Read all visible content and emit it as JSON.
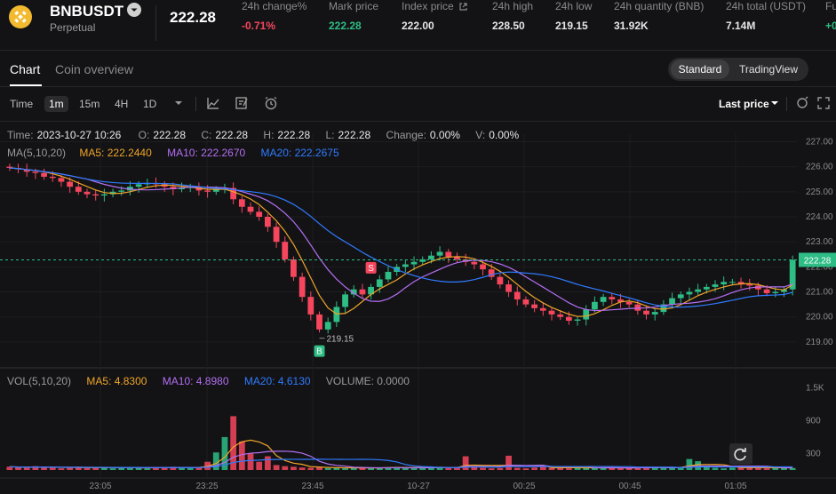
{
  "header": {
    "symbol": "BNBUSDT",
    "subtitle": "Perpetual",
    "last_price": "222.28",
    "stats": [
      {
        "label": "24h change%",
        "value": "-0.71%",
        "color": "#f6465d"
      },
      {
        "label": "Mark price",
        "value": "222.28",
        "color": "#2ebd85"
      },
      {
        "label": "Index price",
        "value": "222.00",
        "color": "#e6e6e6"
      },
      {
        "label": "24h high",
        "value": "228.50",
        "color": "#e6e6e6"
      },
      {
        "label": "24h low",
        "value": "219.15",
        "color": "#e6e6e6"
      },
      {
        "label": "24h quantity (BNB)",
        "value": "31.92K",
        "color": "#e6e6e6"
      },
      {
        "label": "24h total (USDT)",
        "value": "7.14M",
        "color": "#e6e6e6"
      },
      {
        "label": "Fu",
        "value": "+0",
        "color": "#2ebd85"
      }
    ]
  },
  "tabs": {
    "chart": "Chart",
    "coin_overview": "Coin overview"
  },
  "view_switch": {
    "standard": "Standard",
    "tradingview": "TradingView"
  },
  "toolbar": {
    "time_label": "Time",
    "intervals": [
      "1m",
      "15m",
      "4H",
      "1D"
    ],
    "active_interval": "1m",
    "last_price_label": "Last price"
  },
  "ohlc": {
    "time_label": "Time:",
    "time": "2023-10-27 10:26",
    "open_label": "O:",
    "open": "222.28",
    "close_label": "C:",
    "close": "222.28",
    "high_label": "H:",
    "high": "222.28",
    "low_label": "L:",
    "low": "222.28",
    "change_label": "Change:",
    "change": "0.00%",
    "vol_label": "V:",
    "vol": "0.00%"
  },
  "ma_legend": {
    "ma_title": "MA(5,10,20)",
    "ma5": "MA5: 222.2440",
    "ma10": "MA10: 222.2670",
    "ma20": "MA20: 222.2675"
  },
  "vol_legend": {
    "vol_title": "VOL(5,10,20)",
    "ma5": "MA5: 4.8300",
    "ma10": "MA10: 4.8980",
    "ma20": "MA20: 4.6130",
    "volume": "VOLUME: 0.0000"
  },
  "chart_data": {
    "type": "candlestick",
    "price_axis": [
      "227.00",
      "226.00",
      "225.00",
      "224.00",
      "223.00",
      "222.00",
      "221.00",
      "220.00",
      "219.00"
    ],
    "volume_axis": [
      "1.5K",
      "900",
      "300"
    ],
    "time_axis": [
      "23:05",
      "23:25",
      "23:45",
      "10-27",
      "00:25",
      "00:45",
      "01:05"
    ],
    "current_price_tag": "222.28",
    "low_annotation": "219.15",
    "markers": {
      "sell": "S",
      "buy": "B"
    },
    "colors": {
      "up": "#2ebd85",
      "down": "#f6465d",
      "ma5": "#f0a429",
      "ma10": "#b36ff2",
      "ma20": "#2f7bff"
    },
    "ylim": [
      218.5,
      227.3
    ],
    "close_path": [
      225.95,
      225.9,
      225.8,
      225.75,
      225.6,
      225.55,
      225.4,
      225.2,
      225.0,
      224.9,
      224.85,
      224.9,
      225.0,
      225.05,
      225.2,
      225.3,
      225.35,
      225.3,
      225.2,
      225.1,
      225.15,
      225.2,
      225.05,
      225.0,
      225.1,
      225.15,
      224.7,
      224.4,
      224.2,
      224.0,
      223.6,
      223.0,
      222.3,
      221.6,
      220.8,
      220.1,
      219.5,
      219.8,
      220.4,
      220.9,
      221.1,
      220.9,
      221.2,
      221.5,
      221.8,
      222.0,
      222.1,
      222.2,
      222.3,
      222.45,
      222.6,
      222.4,
      222.3,
      222.2,
      222.1,
      221.9,
      221.6,
      221.3,
      221.0,
      220.7,
      220.5,
      220.35,
      220.25,
      220.1,
      220.0,
      219.85,
      219.9,
      220.3,
      220.6,
      220.8,
      220.7,
      220.6,
      220.5,
      220.25,
      220.1,
      220.2,
      220.5,
      220.75,
      220.9,
      221.0,
      221.1,
      221.2,
      221.3,
      221.4,
      221.4,
      221.3,
      221.25,
      221.1,
      220.95,
      221.0,
      221.1,
      222.28
    ],
    "volume_path": [
      60,
      50,
      40,
      70,
      45,
      55,
      30,
      40,
      60,
      35,
      50,
      45,
      30,
      40,
      55,
      35,
      30,
      50,
      45,
      60,
      40,
      35,
      55,
      150,
      320,
      600,
      980,
      520,
      300,
      150,
      250,
      90,
      70,
      60,
      45,
      40,
      55,
      35,
      40,
      30,
      45,
      40,
      35,
      40,
      50,
      55,
      40,
      35,
      40,
      45,
      60,
      35,
      40,
      250,
      60,
      40,
      30,
      35,
      260,
      40,
      30,
      45,
      60,
      35,
      40,
      30,
      45,
      50,
      40,
      35,
      45,
      30,
      40,
      50,
      60,
      40,
      45,
      35,
      55,
      200,
      160,
      50,
      40,
      30,
      45,
      60,
      35,
      40,
      30,
      45,
      55,
      35
    ]
  }
}
